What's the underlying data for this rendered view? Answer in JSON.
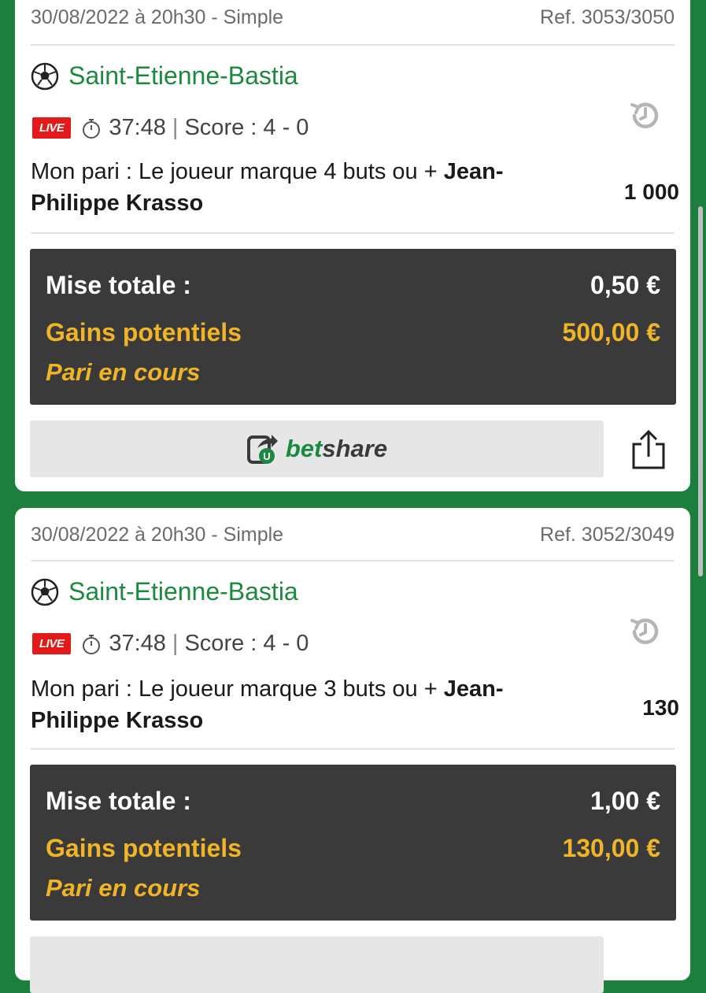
{
  "bets": [
    {
      "meta_left": "30/08/2022 à 20h30 - Simple",
      "meta_right": "Ref. 3053/3050",
      "match": "Saint-Etienne-Bastia",
      "live_label": "LIVE",
      "time": "37:48",
      "score": "Score : 4 - 0",
      "bet_prefix": "Mon pari : Le joueur marque 4 buts ou + ",
      "bet_player": "Jean-Philippe Krasso",
      "odds": "1 000",
      "stake_label": "Mise totale :",
      "stake_value": "0,50 €",
      "gains_label": "Gains potentiels",
      "gains_value": "500,00 €",
      "status": "Pari en cours",
      "betshare_left": "bet",
      "betshare_right": "share"
    },
    {
      "meta_left": "30/08/2022 à 20h30 - Simple",
      "meta_right": "Ref. 3052/3049",
      "match": "Saint-Etienne-Bastia",
      "live_label": "LIVE",
      "time": "37:48",
      "score": "Score : 4 - 0",
      "bet_prefix": "Mon pari : Le joueur marque 3 buts ou + ",
      "bet_player": "Jean-Philippe Krasso",
      "odds": "130",
      "stake_label": "Mise totale :",
      "stake_value": "1,00 €",
      "gains_label": "Gains potentiels",
      "gains_value": "130,00 €",
      "status": "Pari en cours"
    }
  ],
  "colors": {
    "background": "#1c7f3e",
    "accent_green": "#1c8a3e",
    "gold": "#f0b429",
    "live_red": "#e41a1a",
    "summary_bg": "#3a3a3a"
  },
  "icons": [
    "soccer-ball-icon",
    "stopwatch-icon",
    "history-icon",
    "share-icon",
    "betshare-logo-icon"
  ]
}
